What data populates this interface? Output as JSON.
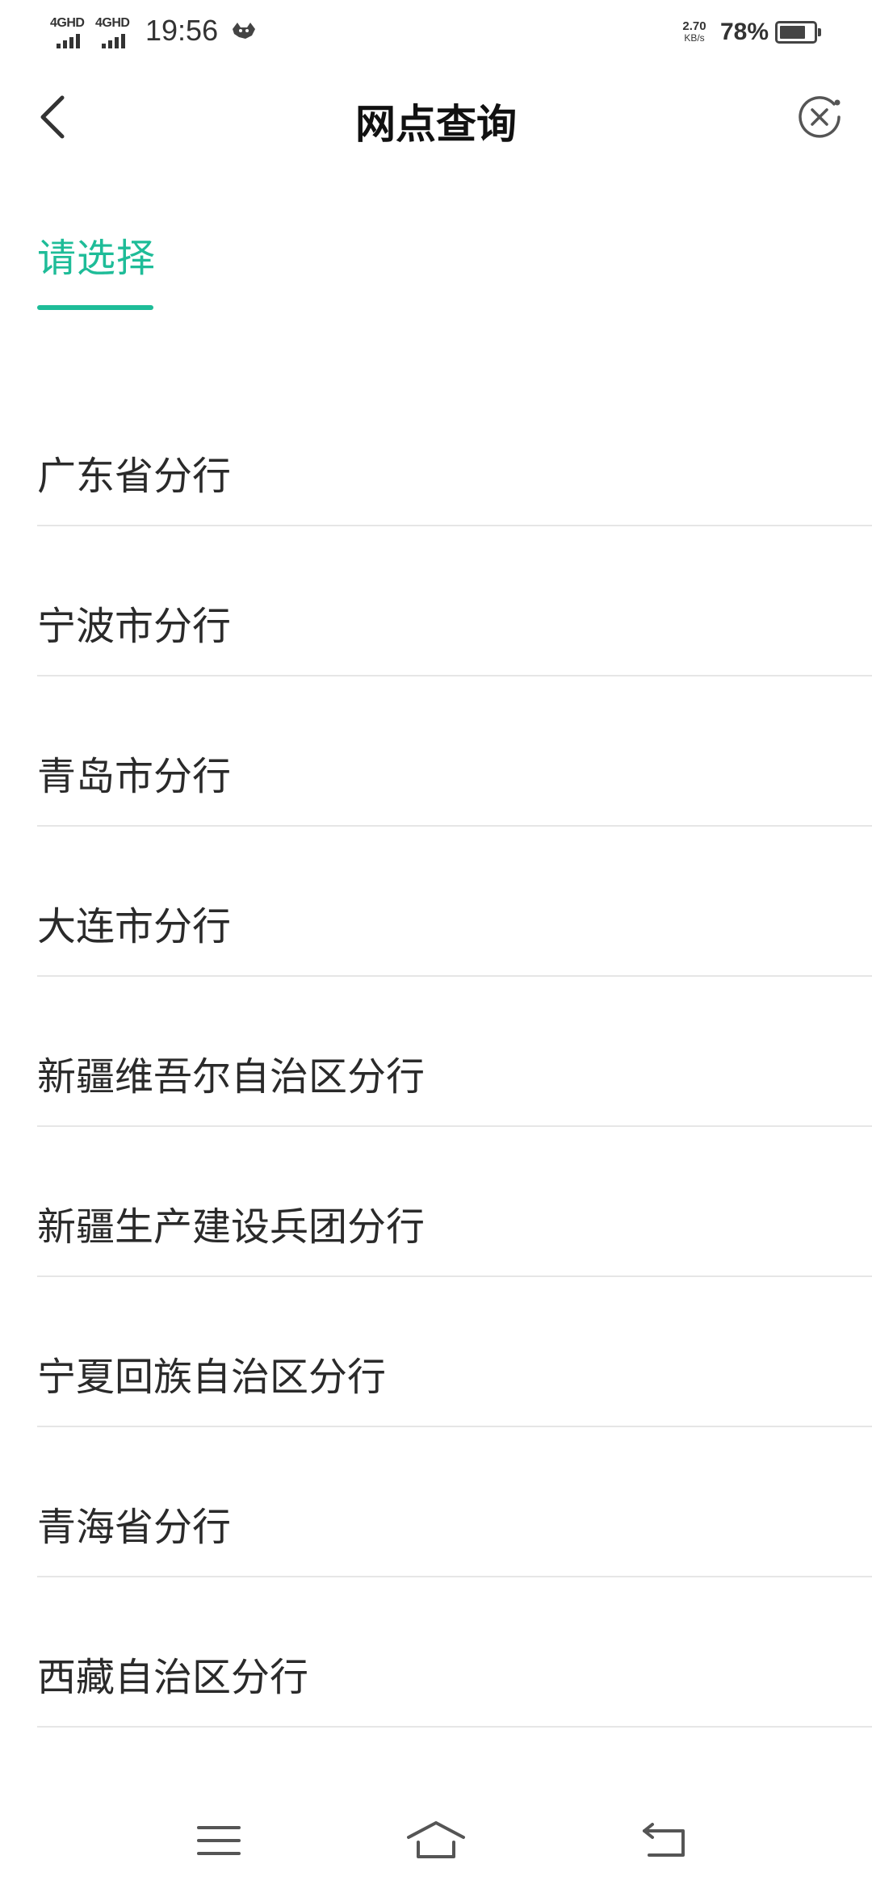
{
  "status_bar": {
    "sim1_label": "4GHD",
    "sim2_label": "4GHD",
    "time": "19:56",
    "net_speed_value": "2.70",
    "net_speed_unit": "KB/s",
    "battery_text": "78%",
    "battery_level": 0.78,
    "icons": [
      "signal-icon",
      "signal-icon",
      "cat-notification-icon",
      "battery-icon"
    ]
  },
  "header": {
    "title": "网点查询",
    "back_icon": "chevron-left-icon",
    "close_icon": "close-circle-icon"
  },
  "tab": {
    "label": "请选择",
    "accent_color": "#1ebc98"
  },
  "branches": [
    "广东省分行",
    "宁波市分行",
    "青岛市分行",
    "大连市分行",
    "新疆维吾尔自治区分行",
    "新疆生产建设兵团分行",
    "宁夏回族自治区分行",
    "青海省分行",
    "西藏自治区分行"
  ],
  "nav_bar": {
    "icons": [
      "menu-icon",
      "home-icon",
      "back-icon"
    ]
  }
}
